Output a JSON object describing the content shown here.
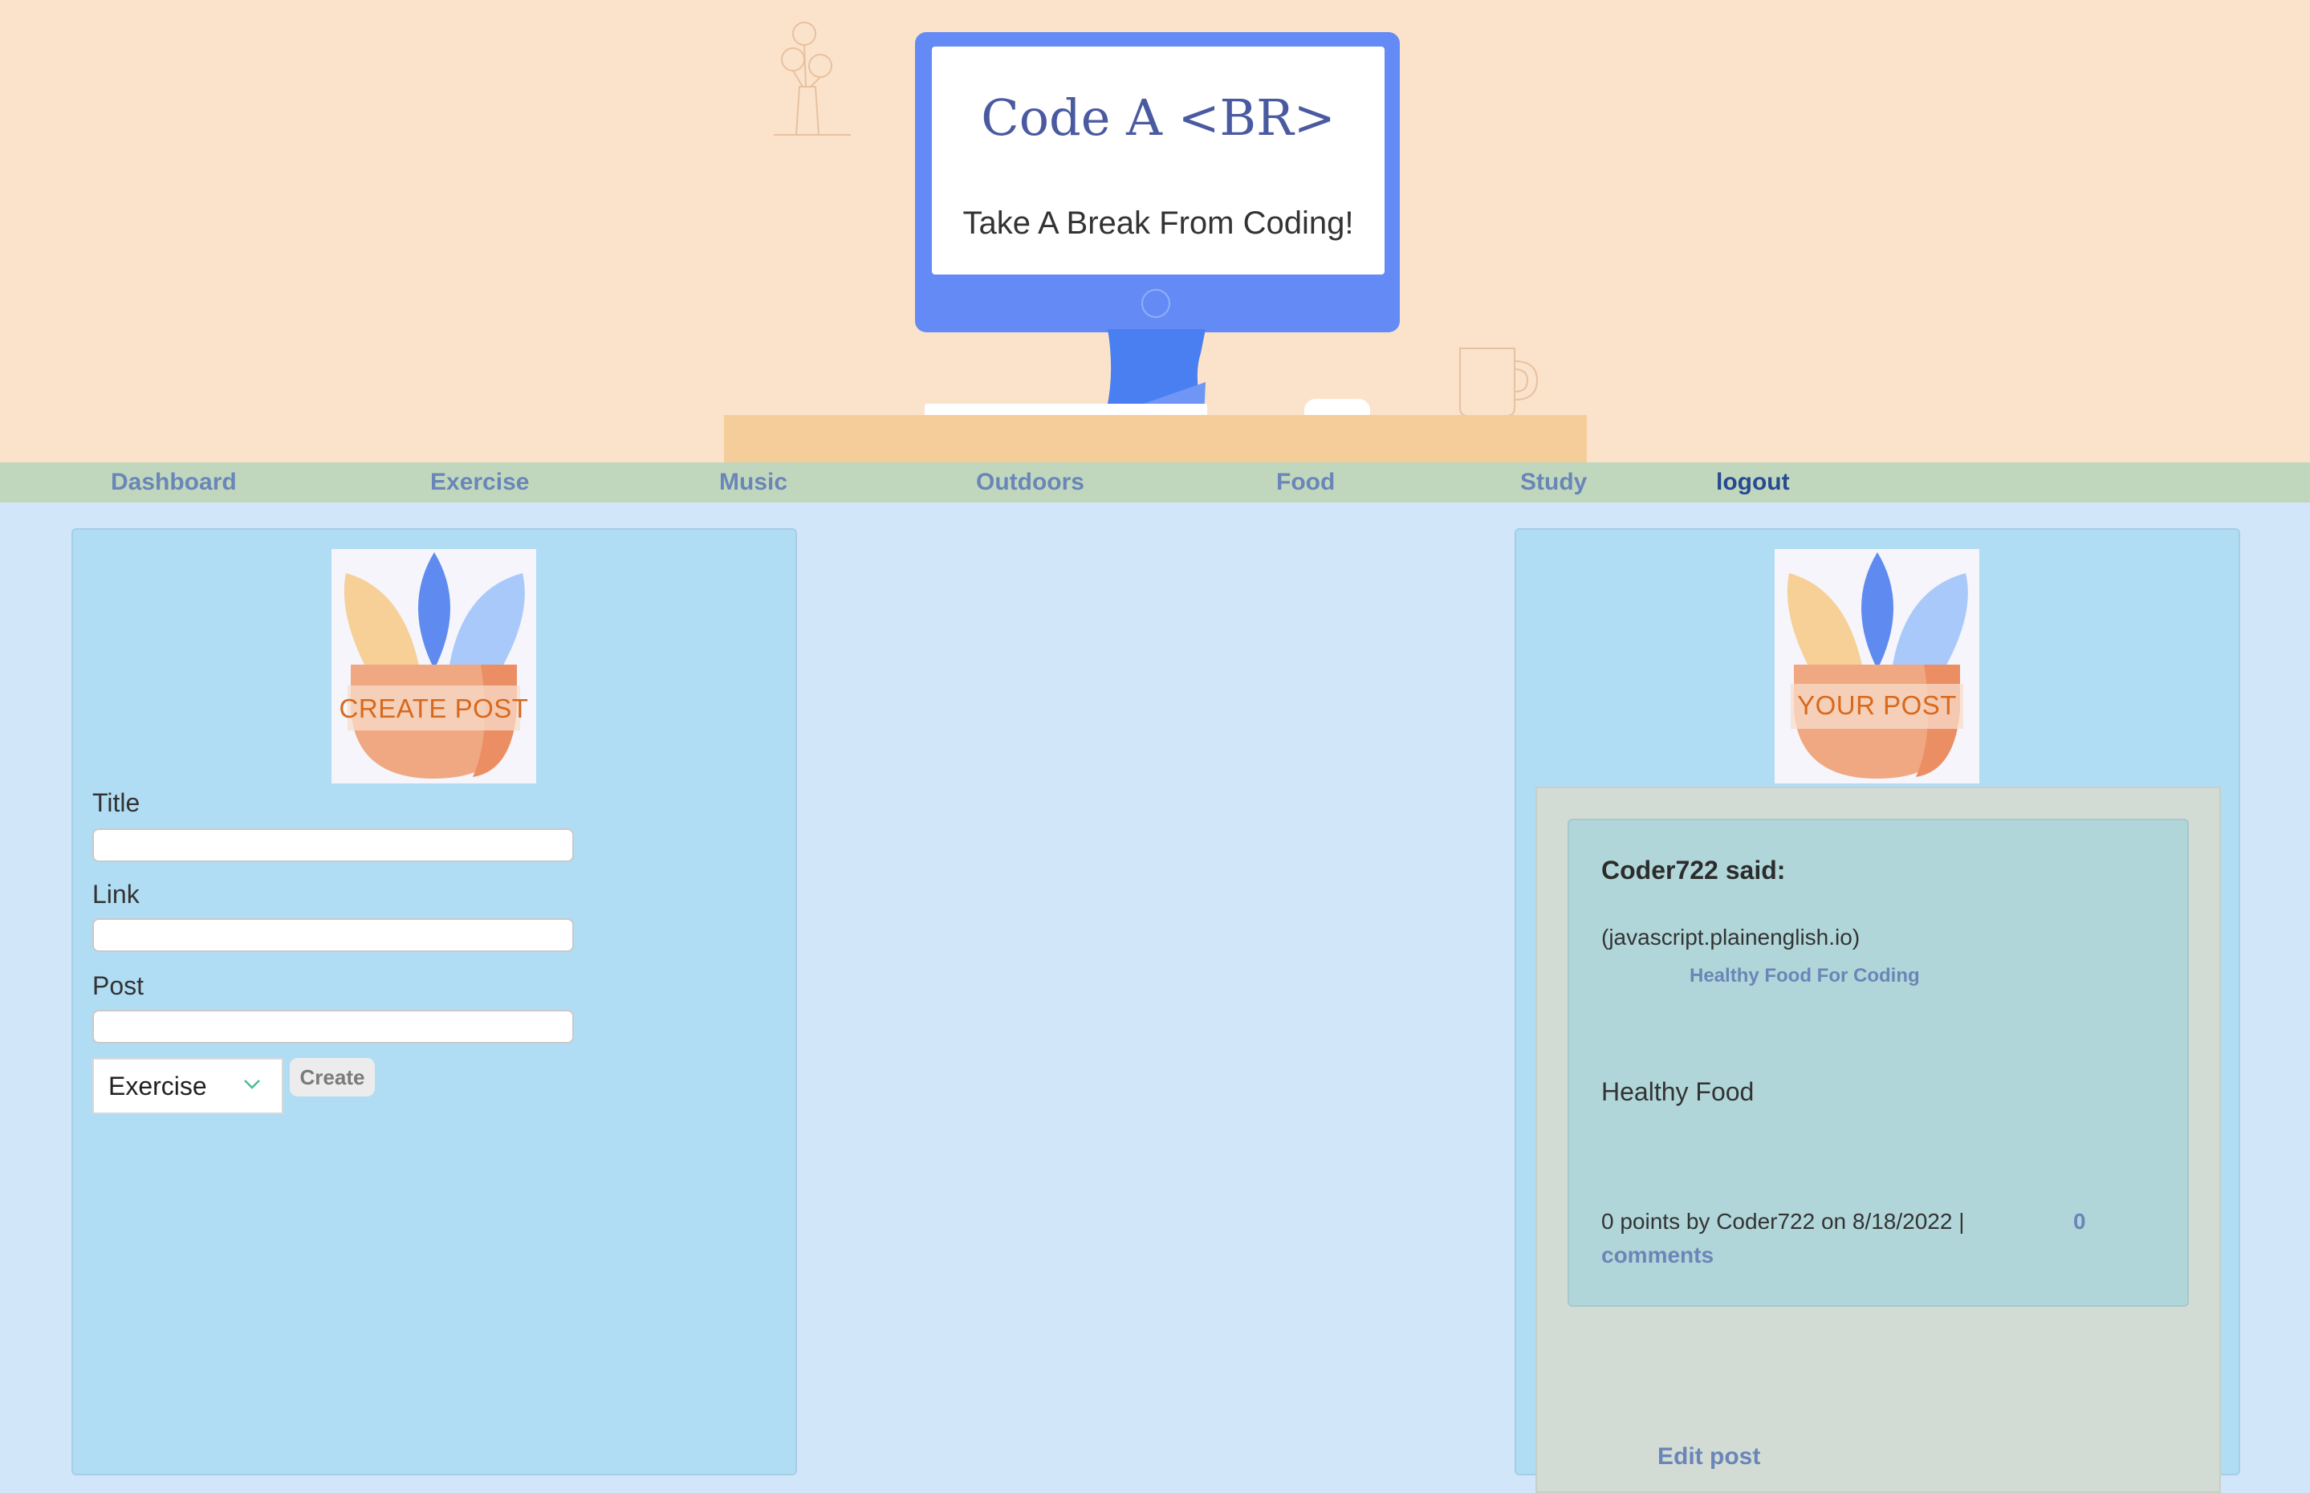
{
  "header": {
    "title": "Code A <BR>",
    "tagline": "Take A Break From Coding!"
  },
  "nav": {
    "items": [
      "Dashboard",
      "Exercise",
      "Music",
      "Outdoors",
      "Food",
      "Study"
    ],
    "logout": "logout"
  },
  "create_panel": {
    "badge_text": "CREATE POST",
    "title_label": "Title",
    "link_label": "Link",
    "post_label": "Post",
    "title_value": "",
    "link_value": "",
    "post_value": "",
    "category_selected": "Exercise",
    "create_button": "Create"
  },
  "your_post_panel": {
    "badge_text": "YOUR POST",
    "post": {
      "author_line": "Coder722 said:",
      "source": "(javascript.plainenglish.io)",
      "link_title": "Healthy Food For Coding",
      "body": "Healthy Food",
      "meta": "0 points by Coder722 on 8/18/2022 |",
      "comments_count": "0",
      "comments_label": "comments"
    },
    "edit_label": "Edit post"
  },
  "colors": {
    "header_bg": "#fbe3cb",
    "nav_bg": "#c1d7bd",
    "page_bg": "#d2e6f9",
    "panel_bg": "#b1ddf4",
    "monitor": "#648bf5",
    "link": "#6a86b8",
    "logout": "#274b90",
    "badge_text": "#d8691c"
  }
}
